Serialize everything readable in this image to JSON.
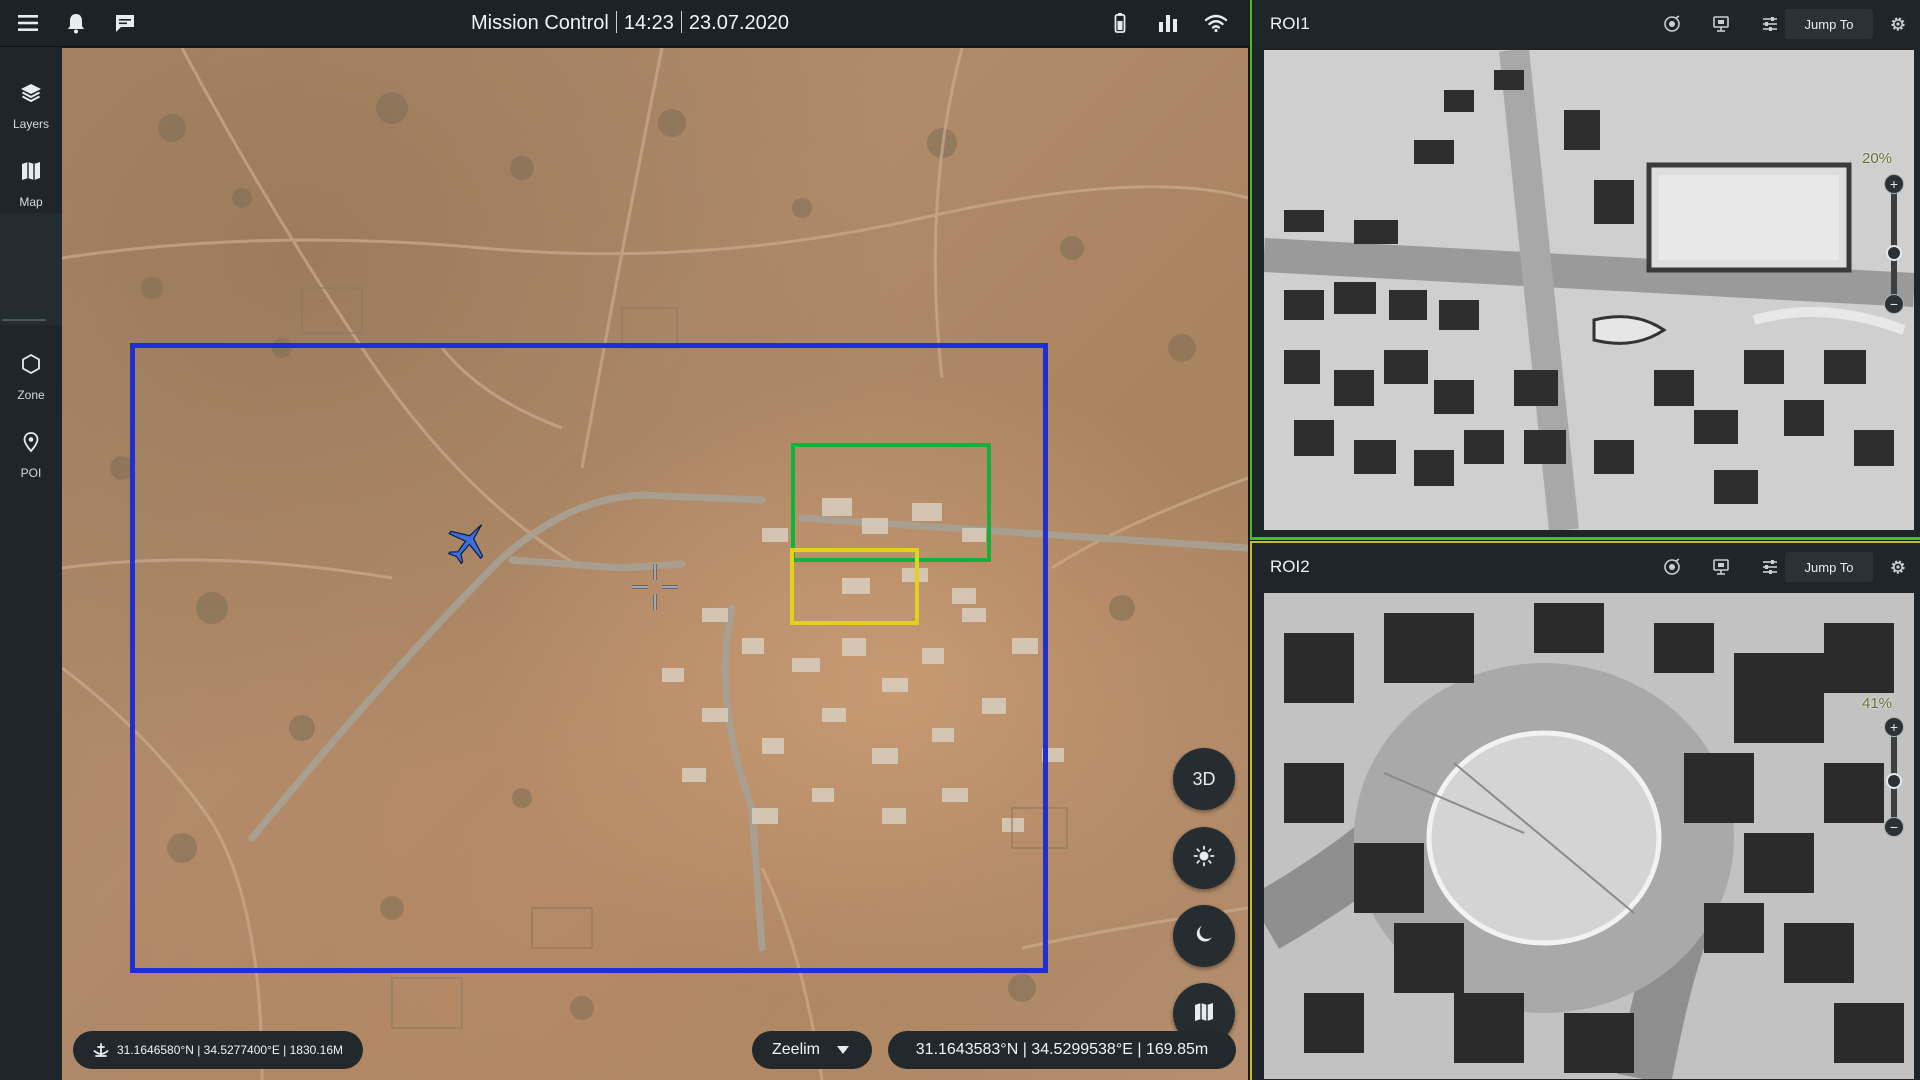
{
  "header": {
    "title": "Mission Control",
    "time": "14:23",
    "date": "23.07.2020",
    "icons": [
      "menu-icon",
      "bell-icon",
      "chat-icon",
      "battery-icon",
      "signal-bars-icon",
      "wifi-icon"
    ]
  },
  "sidebar": {
    "items": [
      {
        "label": "Layers",
        "icon": "layers-icon"
      },
      {
        "label": "Map",
        "icon": "map-icon"
      },
      {
        "label": "Zone",
        "icon": "hexagon-icon"
      },
      {
        "label": "POI",
        "icon": "pin-icon"
      }
    ]
  },
  "map": {
    "controls": [
      "3D",
      "sun-icon",
      "moon-icon",
      "map-icon"
    ],
    "drone_coords": "31.1646580°N | 34.5277400°E | 1830.16M",
    "place": "Zeelim",
    "cursor_coords": "31.1643583°N | 34.5299538°E | 169.85m",
    "zone_colors": {
      "aoi": "#1f2fd8",
      "roi1": "#12b23a",
      "roi2": "#e3d21c"
    }
  },
  "roi_panels": [
    {
      "title": "ROI1",
      "jump_label": "Jump To",
      "zoom": "20%",
      "accent": "#4dbb28"
    },
    {
      "title": "ROI2",
      "jump_label": "Jump To",
      "zoom": "41%",
      "accent": "#c4bc2a"
    }
  ]
}
